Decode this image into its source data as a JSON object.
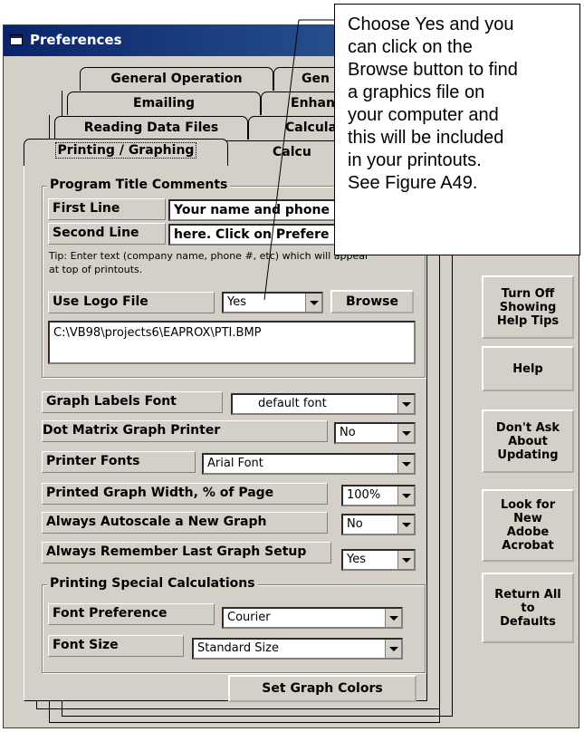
{
  "window": {
    "title": "Preferences"
  },
  "tabs": {
    "row1": [
      "General Operation",
      "Gen"
    ],
    "row2": [
      "Emailing",
      "Enhan"
    ],
    "row3": [
      "Reading Data Files",
      "Calcula"
    ],
    "row4": [
      "Printing / Graphing",
      "Calcu"
    ]
  },
  "program_title": {
    "group_label": "Program Title Comments",
    "first_line_label": "First Line",
    "first_line_value": "Your name and phone",
    "second_line_label": "Second Line",
    "second_line_value": "here.  Click on Prefere",
    "tip": "Tip:  Enter text (company name, phone #, etc) which will appear at top of printouts."
  },
  "logo": {
    "label": "Use Logo File",
    "value": "Yes",
    "browse_label": "Browse",
    "path": "C:\\VB98\\projects6\\EAPROX\\PTI.BMP"
  },
  "settings": [
    {
      "label": "Graph Labels Font",
      "value": "default font"
    },
    {
      "label": "Dot Matrix Graph Printer",
      "value": "No"
    },
    {
      "label": "Printer Fonts",
      "value": "Arial Font"
    },
    {
      "label": "Printed Graph Width, % of Page",
      "value": "100%"
    },
    {
      "label": "Always Autoscale a New Graph",
      "value": "No"
    },
    {
      "label": "Always Remember Last Graph Setup",
      "value": "Yes"
    }
  ],
  "special": {
    "group_label": "Printing Special Calculations",
    "font_pref_label": "Font Preference",
    "font_pref_value": "Courier",
    "font_size_label": "Font Size",
    "font_size_value": "Standard Size"
  },
  "set_colors_label": "Set Graph Colors",
  "side_buttons": {
    "b1": [
      "Turn Off",
      "Showing",
      "Help Tips"
    ],
    "b2": [
      "Help"
    ],
    "b3": [
      "Don't Ask",
      "About",
      "Updating"
    ],
    "b4": [
      "Look for",
      "New",
      "Adobe",
      "Acrobat"
    ],
    "b5": [
      "Return All",
      "to",
      "Defaults"
    ]
  },
  "callout": {
    "lines": [
      "Choose Yes and you",
      "can click on the",
      "Browse button to find",
      "a graphics file on",
      "your computer and",
      "this will be included",
      "in your printouts.",
      "See Figure A49."
    ]
  }
}
